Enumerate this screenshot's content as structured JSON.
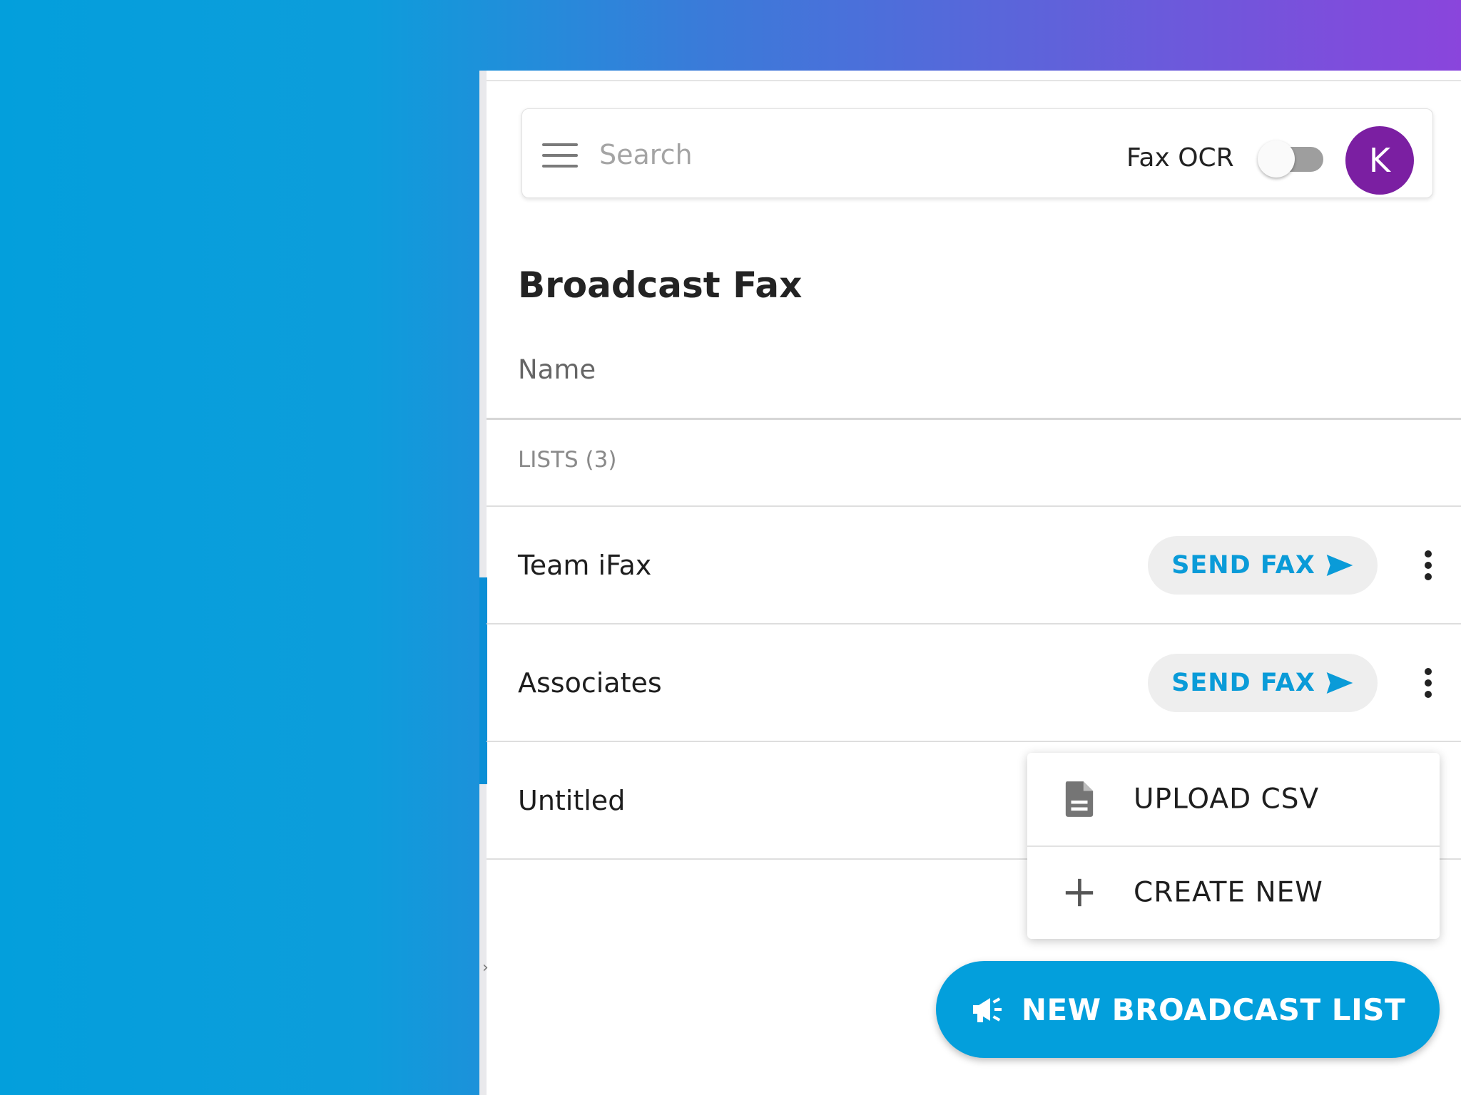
{
  "header": {
    "search": {
      "placeholder": "Search",
      "value": ""
    },
    "fax_ocr": {
      "label": "Fax OCR",
      "enabled": false
    },
    "avatar": {
      "initial": "K",
      "color": "#7b1fa2"
    }
  },
  "page": {
    "title": "Broadcast Fax",
    "column_header": "Name",
    "section_label": "LISTS (3)"
  },
  "lists": [
    {
      "name": "Team iFax",
      "send_label": "SEND FAX"
    },
    {
      "name": "Associates",
      "send_label": "SEND FAX"
    },
    {
      "name": "Untitled"
    }
  ],
  "dropdown": {
    "items": [
      {
        "label": "UPLOAD CSV",
        "icon": "document-icon"
      },
      {
        "label": "CREATE NEW",
        "icon": "plus-icon"
      }
    ]
  },
  "fab": {
    "label": "NEW BROADCAST LIST",
    "icon": "megaphone-icon"
  },
  "colors": {
    "accent": "#039fdc",
    "avatar": "#7b1fa2",
    "send_text": "#0a9bd8"
  }
}
